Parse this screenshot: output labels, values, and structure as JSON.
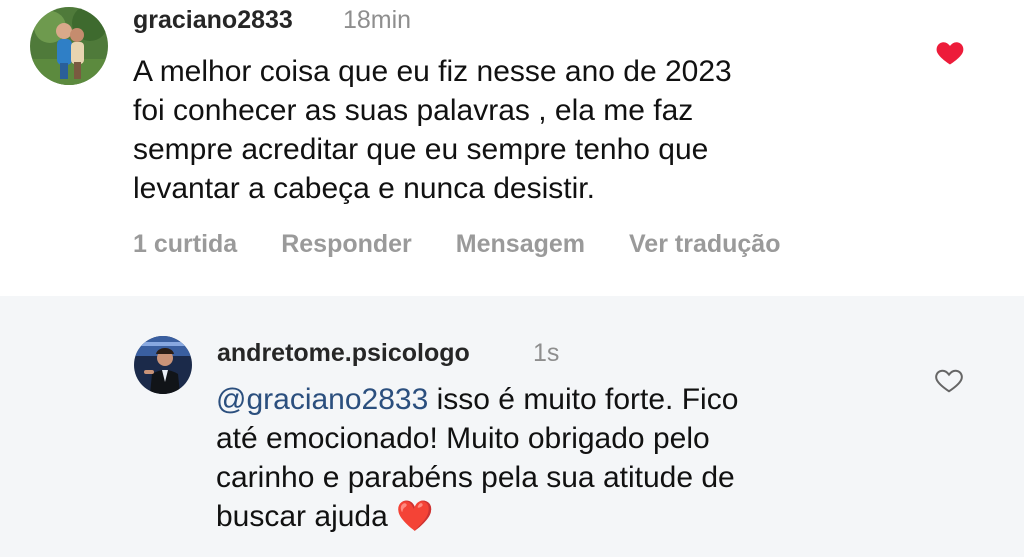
{
  "comment": {
    "username": "graciano2833",
    "time": "18min",
    "text_lines": [
      "A melhor coisa que eu fiz nesse ano de 2023",
      "foi conhecer as suas palavras , ela me faz",
      "sempre acreditar que eu sempre tenho que",
      "levantar a cabeça e nunca desistir."
    ],
    "actions": {
      "likes": "1 curtida",
      "reply": "Responder",
      "message": "Mensagem",
      "translate": "Ver tradução"
    },
    "liked": true,
    "like_color": "#ed1c3a"
  },
  "reply": {
    "username": "andretome.psicologo",
    "time": "1s",
    "mention": "@graciano2833",
    "text_first_line_rest": " isso é muito forte. Fico",
    "text_lines": [
      "até emocionado! Muito obrigado pelo",
      "carinho e parabéns pela sua atitude de"
    ],
    "last_line_text": "buscar ajuda ",
    "emoji": "❤️",
    "liked": false
  },
  "colors": {
    "mention": "#2b4f7e",
    "reply_background": "#f4f6f8",
    "secondary_text": "#8e8e8e"
  }
}
